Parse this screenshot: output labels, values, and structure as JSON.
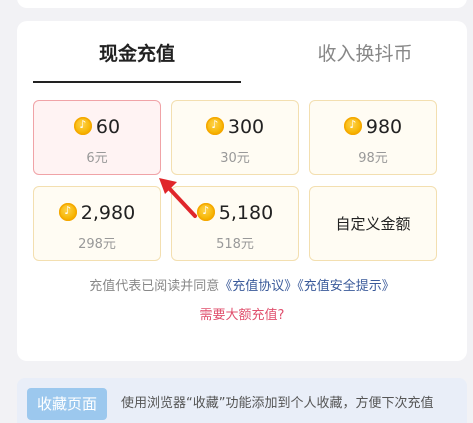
{
  "tabs": {
    "active_label": "现金充值",
    "inactive_label": "收入换抖币"
  },
  "packages": [
    {
      "amount": "60",
      "price": "6元",
      "selected": true
    },
    {
      "amount": "300",
      "price": "30元"
    },
    {
      "amount": "980",
      "price": "98元"
    },
    {
      "amount": "2,980",
      "price": "298元"
    },
    {
      "amount": "5,180",
      "price": "518元"
    }
  ],
  "custom_label": "自定义金额",
  "agreement": {
    "prefix": "充值代表已阅读并同意",
    "link1": "《充值协议》",
    "link2": "《充值安全提示》"
  },
  "big_amount_link": "需要大额充值?",
  "bookmark": {
    "button": "收藏页面",
    "tip": "使用浏览器“收藏”功能添加到个人收藏，方便下次充值"
  },
  "icons": {
    "coin": "douyin-coin-icon",
    "annotation": "red-arrow-annotation"
  },
  "colors": {
    "selected_border": "#f0a3a7",
    "selected_bg": "#fff3f3",
    "package_border": "#f3dfb0",
    "link": "#3a5a9a",
    "big_amount": "#e0506e",
    "bookmark_button": "#9cc8ee",
    "arrow": "#e0262b"
  }
}
